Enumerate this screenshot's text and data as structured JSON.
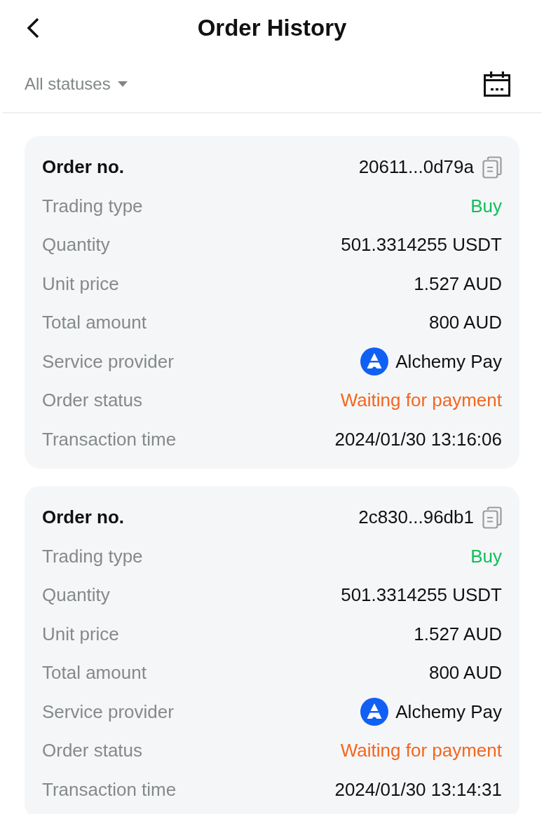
{
  "header": {
    "title": "Order History"
  },
  "filter": {
    "label": "All statuses"
  },
  "orders": [
    {
      "rows": [
        {
          "kind": "order_no",
          "label": "Order no.",
          "value": "20611...0d79a"
        },
        {
          "kind": "side",
          "label": "Trading type",
          "value": "Buy"
        },
        {
          "kind": "plain",
          "label": "Quantity",
          "value": "501.3314255 USDT"
        },
        {
          "kind": "plain",
          "label": "Unit price",
          "value": "1.527 AUD"
        },
        {
          "kind": "plain",
          "label": "Total amount",
          "value": "800 AUD"
        },
        {
          "kind": "provider",
          "label": "Service provider",
          "value": "Alchemy Pay"
        },
        {
          "kind": "status",
          "label": "Order status",
          "value": "Waiting for payment"
        },
        {
          "kind": "plain",
          "label": "Transaction time",
          "value": "2024/01/30 13:16:06"
        }
      ]
    },
    {
      "rows": [
        {
          "kind": "order_no",
          "label": "Order no.",
          "value": "2c830...96db1"
        },
        {
          "kind": "side",
          "label": "Trading type",
          "value": "Buy"
        },
        {
          "kind": "plain",
          "label": "Quantity",
          "value": "501.3314255 USDT"
        },
        {
          "kind": "plain",
          "label": "Unit price",
          "value": "1.527 AUD"
        },
        {
          "kind": "plain",
          "label": "Total amount",
          "value": "800 AUD"
        },
        {
          "kind": "provider",
          "label": "Service provider",
          "value": "Alchemy Pay"
        },
        {
          "kind": "status",
          "label": "Order status",
          "value": "Waiting for payment"
        },
        {
          "kind": "plain",
          "label": "Transaction time",
          "value": "2024/01/30 13:14:31"
        }
      ]
    }
  ]
}
